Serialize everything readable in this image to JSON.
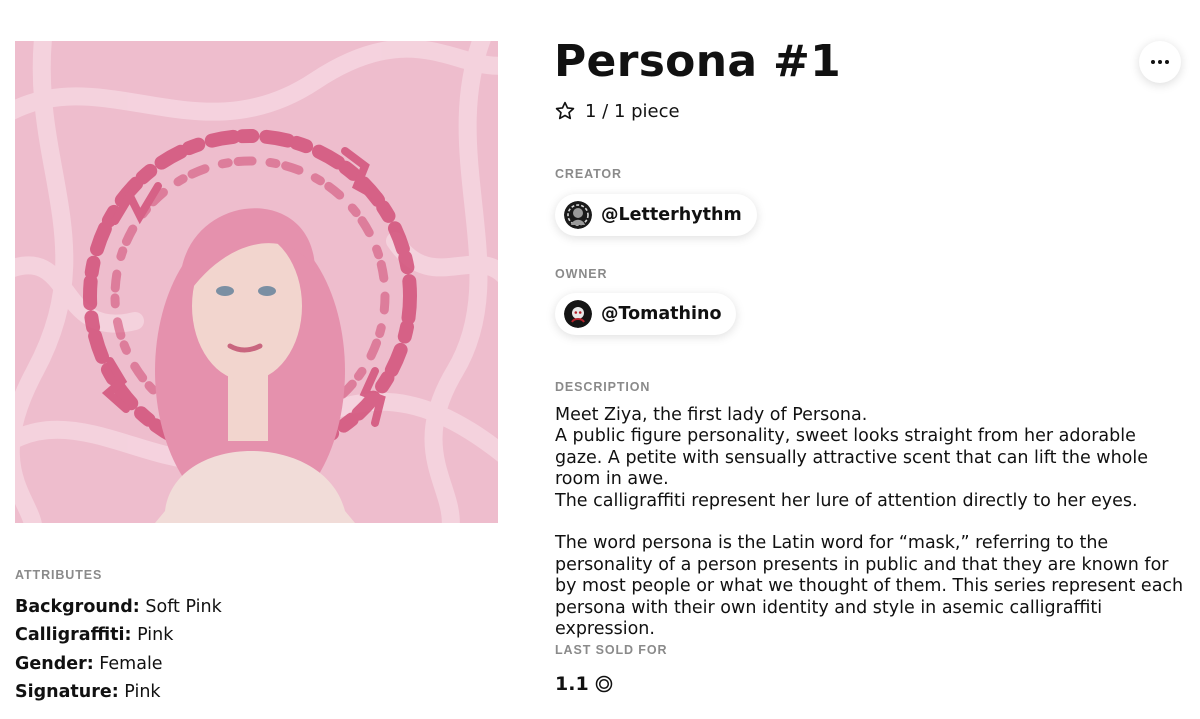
{
  "artwork": {
    "alt": "Persona #1 artwork",
    "colors": {
      "background": "#eebdcd",
      "swirl": "#f6d6e0",
      "calligraphy": "#d4587f",
      "hair": "#e591ad",
      "skin": "#f2d5ce"
    }
  },
  "title": "Persona #1",
  "edition": {
    "icon": "star-outline-icon",
    "text": "1 / 1 piece"
  },
  "creator": {
    "label": "CREATOR",
    "handle": "@Letterhythm",
    "avatar": "creator-avatar"
  },
  "owner": {
    "label": "OWNER",
    "handle": "@Tomathino",
    "avatar": "owner-avatar"
  },
  "description": {
    "label": "DESCRIPTION",
    "paragraphs": [
      "Meet Ziya, the first lady of Persona.\nA public figure personality, sweet looks straight from her adorable gaze. A petite with sensually attractive scent that can lift the whole room in awe.\nThe calligraffiti represent her lure of attention directly to her eyes.",
      "The word persona is the Latin word for “mask,” referring to the personality of a person presents in public and that they are known for by most people or what we thought of them. This series represent each persona with their own identity and style in asemic calligraffiti expression."
    ]
  },
  "attributes": {
    "label": "ATTRIBUTES",
    "items": [
      {
        "key": "Background:",
        "value": "Soft Pink"
      },
      {
        "key": "Calligraffiti:",
        "value": "Pink"
      },
      {
        "key": "Gender:",
        "value": "Female"
      },
      {
        "key": "Signature:",
        "value": "Pink"
      }
    ]
  },
  "last_sold": {
    "label": "LAST SOLD FOR",
    "amount": "1.1",
    "currency_icon": "tezos-currency-icon"
  },
  "more_menu": {
    "icon": "more-horizontal-icon"
  }
}
